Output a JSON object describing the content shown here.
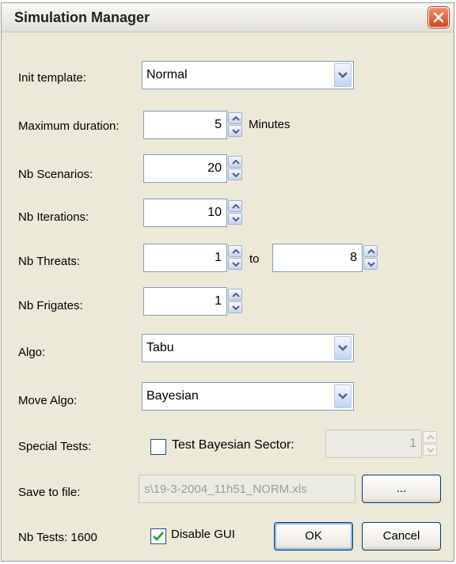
{
  "window": {
    "title": "Simulation Manager"
  },
  "fields": {
    "init_template": {
      "label": "Init template:",
      "value": "Normal"
    },
    "max_duration": {
      "label": "Maximum duration:",
      "value": "5",
      "unit": "Minutes"
    },
    "nb_scenarios": {
      "label": "Nb Scenarios:",
      "value": "20"
    },
    "nb_iterations": {
      "label": "Nb Iterations:",
      "value": "10"
    },
    "nb_threats": {
      "label": "Nb Threats:",
      "from_value": "1",
      "to_label": "to",
      "to_value": "8"
    },
    "nb_frigates": {
      "label": "Nb Frigates:",
      "value": "1"
    },
    "algo": {
      "label": "Algo:",
      "value": "Tabu"
    },
    "move_algo": {
      "label": "Move Algo:",
      "value": "Bayesian"
    },
    "special_tests": {
      "label": "Special Tests:",
      "checkbox_label": "Test Bayesian Sector:",
      "checked": false,
      "value": "1"
    },
    "save_to_file": {
      "label": "Save to file:",
      "value": "s\\19-3-2004_11h51_NORM.xls",
      "browse_label": "..."
    }
  },
  "footer": {
    "nb_tests": "Nb Tests: 1600",
    "disable_gui_label": "Disable GUI",
    "disable_gui_checked": true,
    "ok_label": "OK",
    "cancel_label": "Cancel"
  },
  "colors": {
    "close_button": "#d2461c",
    "field_border": "#7f9db9",
    "dialog_bg": "#ece9d8"
  }
}
